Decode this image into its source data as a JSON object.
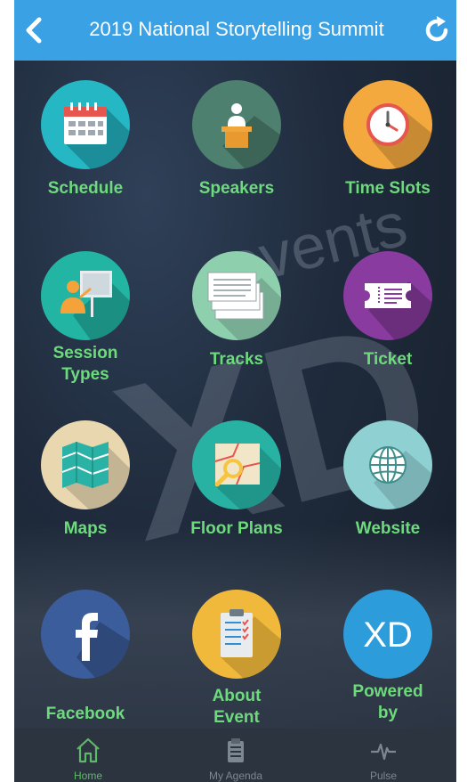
{
  "header": {
    "title": "2019 National Storytelling Summit",
    "back_icon": "chevron-left-icon",
    "refresh_icon": "refresh-icon"
  },
  "colors": {
    "header_bg": "#3aa1e4",
    "label_green": "#6ddb7c",
    "tab_active": "#5fb86a"
  },
  "tiles": [
    {
      "label": "Schedule",
      "icon": "calendar-icon",
      "color": "#25b7c4"
    },
    {
      "label": "Speakers",
      "icon": "speaker-podium-icon",
      "color": "#4e8070"
    },
    {
      "label": "Time Slots",
      "icon": "clock-icon",
      "color": "#f4a93f"
    },
    {
      "label": "Session Types",
      "label_line1": "Session",
      "label_line2": "Types",
      "icon": "presentation-icon",
      "color": "#22b5a3"
    },
    {
      "label": "Tracks",
      "icon": "cards-icon",
      "color": "#8ecfae"
    },
    {
      "label": "Ticket",
      "icon": "ticket-icon",
      "color": "#8a3ba0"
    },
    {
      "label": "Maps",
      "icon": "map-icon",
      "color": "#e9d7b0"
    },
    {
      "label": "Floor Plans",
      "icon": "floor-plan-icon",
      "color": "#27b2a4"
    },
    {
      "label": "Website",
      "icon": "globe-icon",
      "color": "#8fd0d3"
    },
    {
      "label": "Facebook",
      "icon": "facebook-icon",
      "color": "#3b5d9c"
    },
    {
      "label": "About Event",
      "label_line1": "About",
      "label_line2": "Event",
      "icon": "clipboard-icon",
      "color": "#f0b93b"
    },
    {
      "label": "Powered by",
      "label_line1": "Powered",
      "label_line2": "by",
      "icon": "xd-logo-icon",
      "color": "#2d9cdb"
    }
  ],
  "watermark": {
    "text1": "events",
    "text2": "XD"
  },
  "footer": {
    "tabs": [
      {
        "label": "Home",
        "icon": "home-icon",
        "active": true
      },
      {
        "label": "My Agenda",
        "icon": "agenda-icon",
        "active": false
      },
      {
        "label": "Pulse",
        "icon": "pulse-icon",
        "active": false
      }
    ]
  }
}
